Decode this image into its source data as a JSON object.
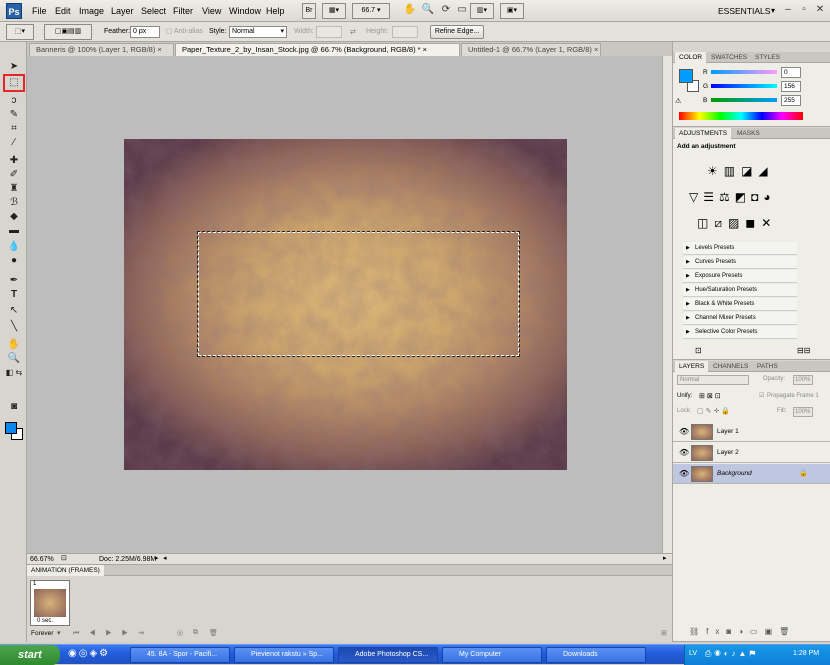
{
  "menubar": {
    "logo": "Ps",
    "items": [
      "File",
      "Edit",
      "Image",
      "Layer",
      "Select",
      "Filter",
      "View",
      "Window",
      "Help"
    ],
    "br_label": "Br",
    "zoom": "66.7",
    "workspace": "ESSENTIALS"
  },
  "options": {
    "feather_label": "Feather:",
    "feather_value": "0 px",
    "antialias_label": "Anti-alias",
    "style_label": "Style:",
    "style_value": "Normal",
    "width_label": "Width:",
    "height_label": "Height:",
    "refine_edge": "Refine Edge..."
  },
  "tabs": [
    {
      "label": "Banneris @ 100% (Layer 1, RGB/8) ×"
    },
    {
      "label": "Paper_Texture_2_by_Insan_Stock.jpg @ 66.7% (Background, RGB/8) * ×"
    },
    {
      "label": "Untitled-1 @ 66.7% (Layer 1, RGB/8) ×"
    }
  ],
  "status": {
    "zoom": "66.67%",
    "doc": "Doc: 2.25M/6.98M"
  },
  "animation": {
    "title": "ANIMATION (FRAMES)",
    "frame_number": "1",
    "frame_delay": "0 sec.",
    "loop": "Forever"
  },
  "color_panel": {
    "tabs": [
      "COLOR",
      "SWATCHES",
      "STYLES"
    ],
    "r_label": "R",
    "r_value": "0",
    "g_label": "G",
    "g_value": "156",
    "b_label": "B",
    "b_value": "255",
    "fg_color": "#009cff"
  },
  "adjustments": {
    "tabs": [
      "ADJUSTMENTS",
      "MASKS"
    ],
    "heading": "Add an adjustment",
    "presets": [
      "Levels Presets",
      "Curves Presets",
      "Exposure Presets",
      "Hue/Saturation Presets",
      "Black & White Presets",
      "Channel Mixer Presets",
      "Selective Color Presets"
    ]
  },
  "layers": {
    "tabs": [
      "LAYERS",
      "CHANNELS",
      "PATHS"
    ],
    "blend_mode": "Normal",
    "opacity_label": "Opacity:",
    "opacity_value": "100%",
    "unify_label": "Unify:",
    "propagate_label": "Propagate Frame 1",
    "lock_label": "Lock:",
    "fill_label": "Fill:",
    "fill_value": "100%",
    "items": [
      "Layer 1",
      "Layer 2",
      "Background"
    ]
  },
  "taskbar": {
    "start": "start",
    "tasks": [
      "45. 8A - Spor - Pacifi...",
      "Pievienot rakstu » Sp...",
      "Adobe Photoshop CS...",
      "My Computer",
      "Downloads"
    ],
    "lang": "LV",
    "time": "1:28 PM"
  }
}
